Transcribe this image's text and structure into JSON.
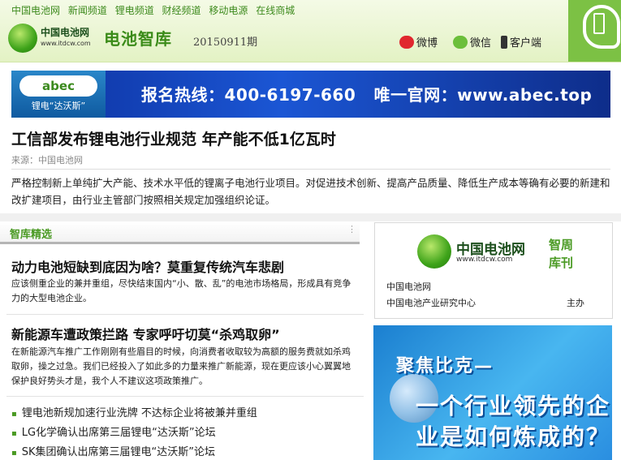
{
  "header": {
    "nav": [
      "中国电池网",
      "新闻频道",
      "锂电频道",
      "财经频道",
      "移动电源",
      "在线商城"
    ],
    "logo_name": "中国电池网",
    "logo_url": "www.itdcw.com",
    "brand": "电池智库",
    "issue": "20150911期",
    "social": {
      "weibo": "微博",
      "weixin": "微信",
      "client": "客户端"
    }
  },
  "banner": {
    "logo": "abec",
    "logo_sub": "锂电“达沃斯”",
    "text": "报名热线：400-6197-660   唯一官网：www.abec.top"
  },
  "article": {
    "title": "工信部发布锂电池行业规范 年产能不低1亿瓦时",
    "source": "来源：中国电池网",
    "summary": "严格控制新上单纯扩大产能、技术水平低的锂离子电池行业项目。对促进技术创新、提高产品质量、降低生产成本等确有必要的新建和改扩建项目，由行业主管部门按照相关规定加强组织论证。"
  },
  "section": {
    "title": "智库精选",
    "dots": "⋮",
    "news": [
      {
        "title": "动力电池短缺到底因为啥？莫重复传统汽车悲剧",
        "desc": "应该侧重企业的兼并重组，尽快结束国内“小、散、乱”的电池市场格局，形成具有竞争力的大型电池企业。"
      },
      {
        "title": "新能源车遭政策拦路 专家呼吁切莫“杀鸡取卵”",
        "desc": "在新能源汽车推广工作刚刚有些眉目的时候，向消费者收取较为高额的服务费就如杀鸡取卵，操之过急。我们已经投入了如此多的力量来推广新能源，现在更应该小心翼翼地保护良好势头才是，我个人不建议这项政策推广。"
      }
    ],
    "bullets": [
      "锂电池新规加速行业洗牌 不达标企业将被兼并重组",
      "LG化学确认出席第三届锂电“达沃斯”论坛",
      "SK集团确认出席第三届锂电“达沃斯”论坛"
    ]
  },
  "weekly": {
    "name": "中国电池网",
    "url": "www.itdcw.com",
    "tag": "智周库刊",
    "org1": "中国电池网",
    "org2": "中国电池产业研究中心",
    "role": "主办"
  },
  "ad": {
    "line1": "聚焦比克—",
    "line2": "一个行业领先的企",
    "line3": "业是如何炼成的？"
  }
}
